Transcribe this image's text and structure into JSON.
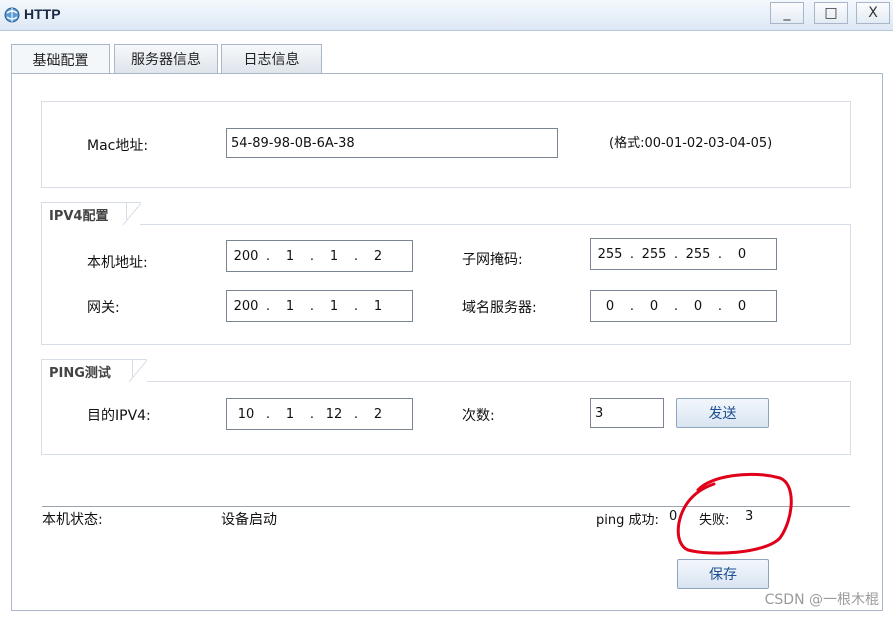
{
  "window": {
    "title": "HTTP",
    "minimize": "_",
    "maximize": "□",
    "close": "X",
    "icon": "network-globe-icon"
  },
  "tabs": [
    {
      "label": "基础配置",
      "active": true
    },
    {
      "label": "服务器信息",
      "active": false
    },
    {
      "label": "日志信息",
      "active": false
    }
  ],
  "mac": {
    "label": "Mac地址:",
    "value": "54-89-98-0B-6A-38",
    "format_hint": "(格式:00-01-02-03-04-05)"
  },
  "ipv4": {
    "group_title": "IPV4配置",
    "local_ip": {
      "label": "本机地址:",
      "octets": [
        "200",
        "1",
        "1",
        "2"
      ]
    },
    "subnet_mask": {
      "label": "子网掩码:",
      "octets": [
        "255",
        "255",
        "255",
        "0"
      ]
    },
    "gateway": {
      "label": "网关:",
      "octets": [
        "200",
        "1",
        "1",
        "1"
      ]
    },
    "dns": {
      "label": "域名服务器:",
      "octets": [
        "0",
        "0",
        "0",
        "0"
      ]
    }
  },
  "ping": {
    "group_title": "PING测试",
    "dest_label": "目的IPV4:",
    "dest_octets": [
      "10",
      "1",
      "12",
      "2"
    ],
    "count_label": "次数:",
    "count_value": "3",
    "send_button": "发送"
  },
  "status": {
    "label": "本机状态:",
    "value": "设备启动",
    "ping_success_label": "ping 成功:",
    "ping_success_value": "0",
    "fail_label": "失败:",
    "fail_value": "3"
  },
  "save_button": "保存",
  "watermark": "CSDN @一根木棍",
  "colors": {
    "annotation": "#e0001a",
    "button_text": "#1d4f91",
    "titlebar": "#dde8f5"
  }
}
